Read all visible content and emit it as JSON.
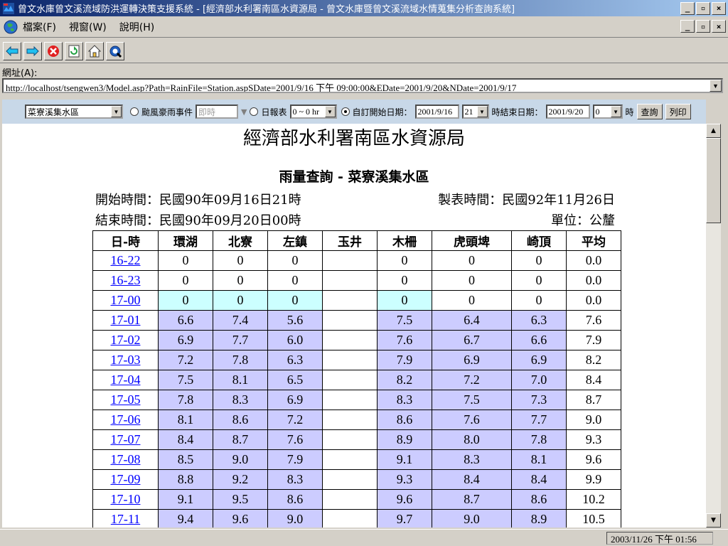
{
  "window": {
    "title": "曾文水庫曾文溪流域防洪運轉決策支援系統 - [經濟部水利署南區水資源局 - 曾文水庫暨曾文溪流域水情蒐集分析查詢系統]"
  },
  "menu": [
    "檔案(F)",
    "視窗(W)",
    "說明(H)"
  ],
  "toolbar_icons": [
    "back-arrow-icon",
    "forward-arrow-icon",
    "stop-icon",
    "refresh-icon",
    "home-icon",
    "search-icon"
  ],
  "address": {
    "label": "網址(A):",
    "url": "http://localhost/tsengwen3/Model.asp?Path=RainFile=Station.aspSDate=2001/9/16 下午 09:00:00&EDate=2001/9/20&NDate=2001/9/17"
  },
  "controls": {
    "basin": "菜寮溪集水區",
    "typhoon_label": "颱風豪雨事件",
    "typhoon_value": "即時",
    "daily_label": "日報表",
    "hour_range": "0 ~ 0 hr",
    "custom_start_label": "自訂開始日期：",
    "start_date": "2001/9/16",
    "start_hour": "21",
    "end_label": "時結束日期：",
    "end_date": "2001/9/20",
    "end_hour": "0",
    "hour_suffix": "時",
    "query_button": "查詢",
    "print_button": "列印"
  },
  "report": {
    "agency": "經濟部水利署南區水資源局",
    "title": "雨量查詢 - 菜寮溪集水區",
    "start_time": "開始時間：民國90年09月16日21時",
    "end_time": "結束時間：民國90年09月20日00時",
    "made_time": "製表時間：民國92年11月26日",
    "unit": "單位：公釐"
  },
  "table": {
    "headers": [
      "日-時",
      "環湖",
      "北寮",
      "左鎮",
      "玉井",
      "木柵",
      "虎頭埤",
      "崎頂",
      "平均"
    ],
    "rows": [
      [
        "16-22",
        "0",
        "0",
        "0",
        "",
        "0",
        "0",
        "0",
        "0.0"
      ],
      [
        "16-23",
        "0",
        "0",
        "0",
        "",
        "0",
        "0",
        "0",
        "0.0"
      ],
      [
        "17-00",
        "0",
        "0",
        "0",
        "",
        "0",
        "0",
        "0",
        "0.0"
      ],
      [
        "17-01",
        "6.6",
        "7.4",
        "5.6",
        "",
        "7.5",
        "6.4",
        "6.3",
        "7.6"
      ],
      [
        "17-02",
        "6.9",
        "7.7",
        "6.0",
        "",
        "7.6",
        "6.7",
        "6.6",
        "7.9"
      ],
      [
        "17-03",
        "7.2",
        "7.8",
        "6.3",
        "",
        "7.9",
        "6.9",
        "6.9",
        "8.2"
      ],
      [
        "17-04",
        "7.5",
        "8.1",
        "6.5",
        "",
        "8.2",
        "7.2",
        "7.0",
        "8.4"
      ],
      [
        "17-05",
        "7.8",
        "8.3",
        "6.9",
        "",
        "8.3",
        "7.5",
        "7.3",
        "8.7"
      ],
      [
        "17-06",
        "8.1",
        "8.6",
        "7.2",
        "",
        "8.6",
        "7.6",
        "7.7",
        "9.0"
      ],
      [
        "17-07",
        "8.4",
        "8.7",
        "7.6",
        "",
        "8.9",
        "8.0",
        "7.8",
        "9.3"
      ],
      [
        "17-08",
        "8.5",
        "9.0",
        "7.9",
        "",
        "9.1",
        "8.3",
        "8.1",
        "9.6"
      ],
      [
        "17-09",
        "8.8",
        "9.2",
        "8.3",
        "",
        "9.3",
        "8.4",
        "8.4",
        "9.9"
      ],
      [
        "17-10",
        "9.1",
        "9.5",
        "8.6",
        "",
        "9.6",
        "8.7",
        "8.6",
        "10.2"
      ],
      [
        "17-11",
        "9.4",
        "9.6",
        "9.0",
        "",
        "9.7",
        "9.0",
        "8.9",
        "10.5"
      ]
    ]
  },
  "status": {
    "datetime": "2003/11/26  下午 01:56"
  },
  "colors": {
    "zero_highlight": "#ccffff",
    "rain_highlight": "#ccccff",
    "control_bar": "#c8d8e8"
  }
}
